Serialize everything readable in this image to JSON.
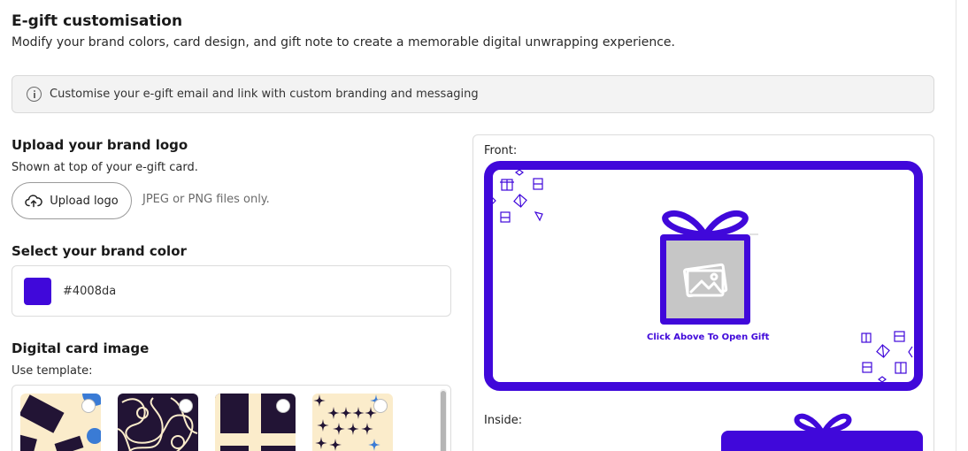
{
  "header": {
    "title": "E-gift customisation",
    "subtitle": "Modify your brand colors, card design, and gift note to create a memorable digital unwrapping experience."
  },
  "info": {
    "icon": "info-icon",
    "text": "Customise your e-gift email and link with custom branding and messaging"
  },
  "logo": {
    "title": "Upload your brand logo",
    "subtitle": "Shown at top of your e-gift card.",
    "button_label": "Upload logo",
    "button_icon": "cloud-upload-icon",
    "hint": "JPEG or PNG files only."
  },
  "brand_color": {
    "title": "Select your brand color",
    "value": "#4008da"
  },
  "card_image": {
    "title": "Digital card image",
    "subtitle": "Use template:",
    "templates": [
      {
        "name": "geometric-shapes"
      },
      {
        "name": "swirls"
      },
      {
        "name": "cross-blocks"
      },
      {
        "name": "sparkles"
      }
    ]
  },
  "preview": {
    "front_label": "Front:",
    "open_text": "Click Above To Open Gift",
    "inside_label": "Inside:"
  },
  "colors": {
    "brand": "#4008da",
    "navy": "#221435",
    "cream": "#fbeccb",
    "blue": "#3a7bd5"
  }
}
